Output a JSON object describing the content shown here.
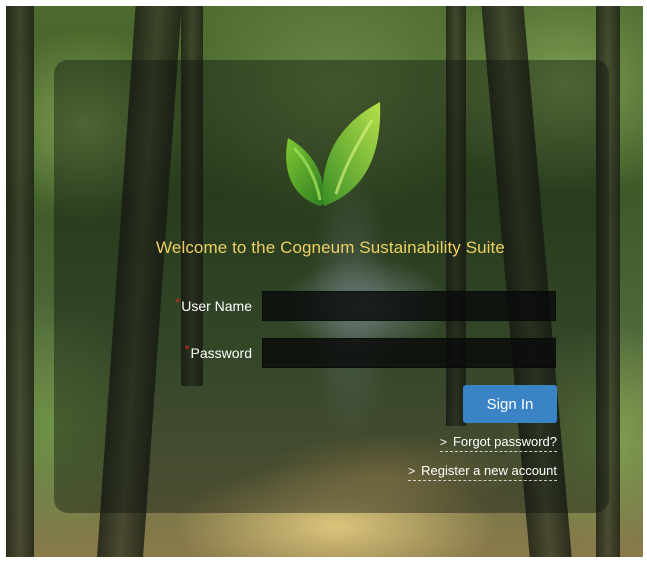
{
  "login": {
    "welcome_text": "Welcome to the Cogneum Sustainability Suite",
    "username": {
      "label": "User Name",
      "required_marker": "*",
      "value": "",
      "placeholder": ""
    },
    "password": {
      "label": "Password",
      "required_marker": "*",
      "value": "",
      "placeholder": ""
    },
    "signin_label": "Sign In",
    "forgot_password_label": "Forgot password?",
    "register_label": "Register a new account",
    "link_chevron": ">"
  },
  "icons": {
    "logo": "leaf-logo-icon",
    "link_chevron": "chevron-right-icon"
  },
  "colors": {
    "welcome_text": "#ecd063",
    "signin_button": "#3a84c6",
    "required_marker": "#d22d2d",
    "leaf_dark": "#3f9a2a",
    "leaf_light": "#9cd43a"
  }
}
